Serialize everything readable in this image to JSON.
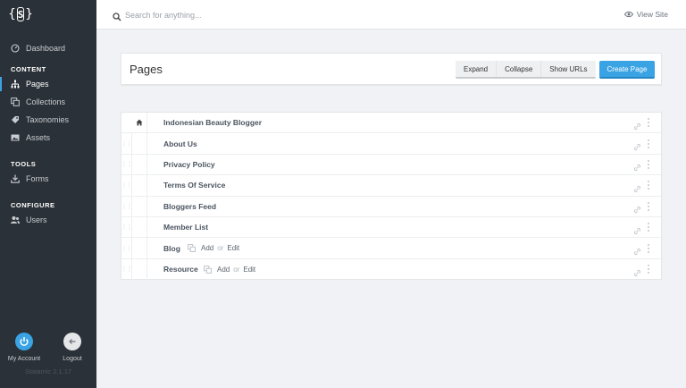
{
  "sidebar": {
    "logo": "S",
    "nav": [
      {
        "label": "Dashboard",
        "icon": "dashboard-icon",
        "active": false
      },
      {
        "label": "Pages",
        "icon": "sitemap-icon",
        "active": true
      },
      {
        "label": "Collections",
        "icon": "collections-icon",
        "active": false
      },
      {
        "label": "Taxonomies",
        "icon": "tag-icon",
        "active": false
      },
      {
        "label": "Assets",
        "icon": "image-icon",
        "active": false
      },
      {
        "label": "Forms",
        "icon": "download-icon",
        "active": false
      },
      {
        "label": "Users",
        "icon": "users-icon",
        "active": false
      }
    ],
    "sections": {
      "content": "CONTENT",
      "tools": "TOOLS",
      "configure": "CONFIGURE"
    },
    "my_account": "My Account",
    "logout": "Logout",
    "version": "Statamic 2.1.17"
  },
  "topbar": {
    "search_placeholder": "Search for anything...",
    "view_site": "View Site"
  },
  "header": {
    "title": "Pages",
    "expand": "Expand",
    "collapse": "Collapse",
    "show_urls": "Show URLs",
    "create_page": "Create Page"
  },
  "pages": [
    {
      "title": "Indonesian Beauty Blogger",
      "home": true
    },
    {
      "title": "About Us"
    },
    {
      "title": "Privacy Policy"
    },
    {
      "title": "Terms Of Service"
    },
    {
      "title": "Bloggers Feed"
    },
    {
      "title": "Member List"
    },
    {
      "title": "Blog",
      "collection": true
    },
    {
      "title": "Resource",
      "collection": true
    }
  ],
  "collection_links": {
    "add": "Add",
    "or": "or",
    "edit": "Edit"
  },
  "colors": {
    "sidebar": "#2b3138",
    "accent": "#3aa3e3",
    "background": "#f1f2f5"
  }
}
